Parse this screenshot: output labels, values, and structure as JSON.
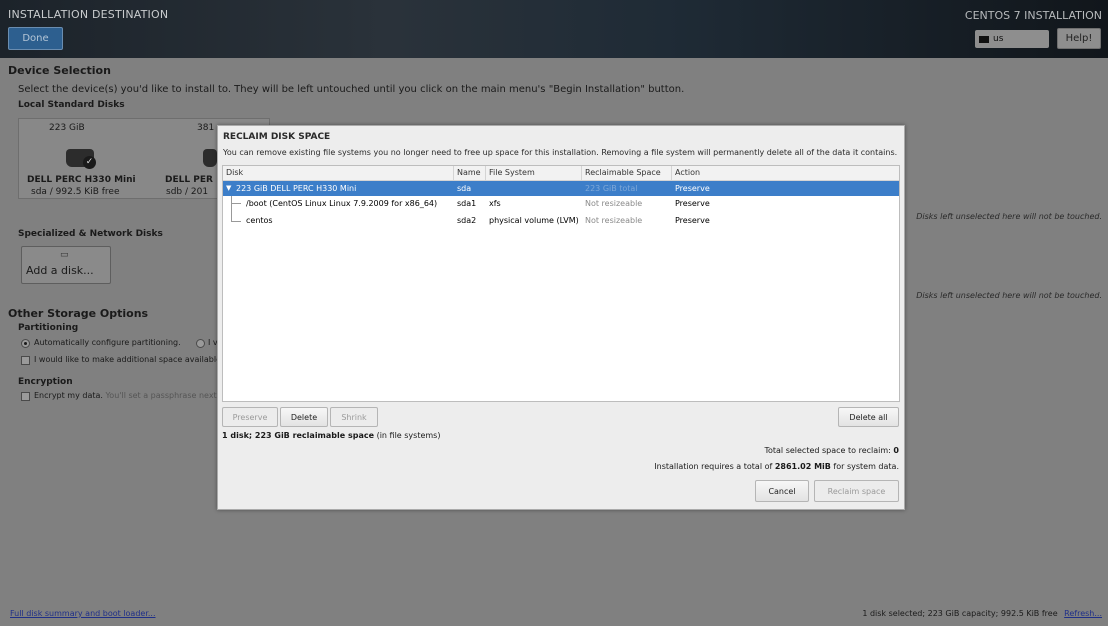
{
  "header": {
    "title": "INSTALLATION DESTINATION",
    "done_label": "Done",
    "product": "CENTOS 7 INSTALLATION",
    "keyboard": "us",
    "help_label": "Help!"
  },
  "device_selection": {
    "heading": "Device Selection",
    "description": "Select the device(s) you'd like to install to.  They will be left untouched until you click on the main menu's \"Begin Installation\" button.",
    "local_heading": "Local Standard Disks",
    "disks": [
      {
        "size": "223 GiB",
        "name": "DELL PERC H330 Mini",
        "info": "sda  /  992.5 KiB free"
      },
      {
        "size": "381",
        "name": "DELL PER",
        "info": "sdb  /  201"
      }
    ],
    "untouched_note_1": "Disks left unselected here will not be touched.",
    "specialized_heading": "Specialized & Network Disks",
    "add_disk_label": "Add a disk...",
    "untouched_note_2": "Disks left unselected here will not be touched."
  },
  "storage_options": {
    "heading": "Other Storage Options",
    "partitioning_label": "Partitioning",
    "auto_label": "Automatically configure partitioning.",
    "manual_fragment": "I v",
    "additional_space_label": "I would like to make additional space available",
    "encryption_label": "Encryption",
    "encrypt_label": "Encrypt my data.",
    "encrypt_hint": "You'll set a passphrase next."
  },
  "footer": {
    "summary_link": "Full disk summary and boot loader...",
    "status": "1 disk selected; 223 GiB capacity; 992.5 KiB free",
    "refresh_link": "Refresh..."
  },
  "dialog": {
    "title": "RECLAIM DISK SPACE",
    "description": "You can remove existing file systems you no longer need to free up space for this installation.  Removing a file system will permanently delete all of the data it contains.",
    "columns": [
      "Disk",
      "Name",
      "File System",
      "Reclaimable Space",
      "Action"
    ],
    "rows": [
      {
        "disk": "223 GiB DELL PERC H330 Mini",
        "name": "sda",
        "fs": "",
        "reclaim": "223 GiB total",
        "action": "Preserve"
      },
      {
        "disk": "/boot (CentOS Linux Linux 7.9.2009 for x86_64)",
        "name": "sda1",
        "fs": "xfs",
        "reclaim": "Not resizeable",
        "action": "Preserve"
      },
      {
        "disk": "centos",
        "name": "sda2",
        "fs": "physical volume (LVM)",
        "reclaim": "Not resizeable",
        "action": "Preserve"
      }
    ],
    "preserve_label": "Preserve",
    "delete_label": "Delete",
    "shrink_label": "Shrink",
    "delete_all_label": "Delete all",
    "summary_bold": "1 disk; 223 GiB reclaimable space",
    "summary_rest": " (in file systems)",
    "total_selected_label": "Total selected space to reclaim:",
    "total_selected_value": "0",
    "requires_prefix": "Installation requires a total of ",
    "requires_value": "2861.02 MiB",
    "requires_suffix": " for system data.",
    "cancel_label": "Cancel",
    "reclaim_label": "Reclaim space"
  }
}
